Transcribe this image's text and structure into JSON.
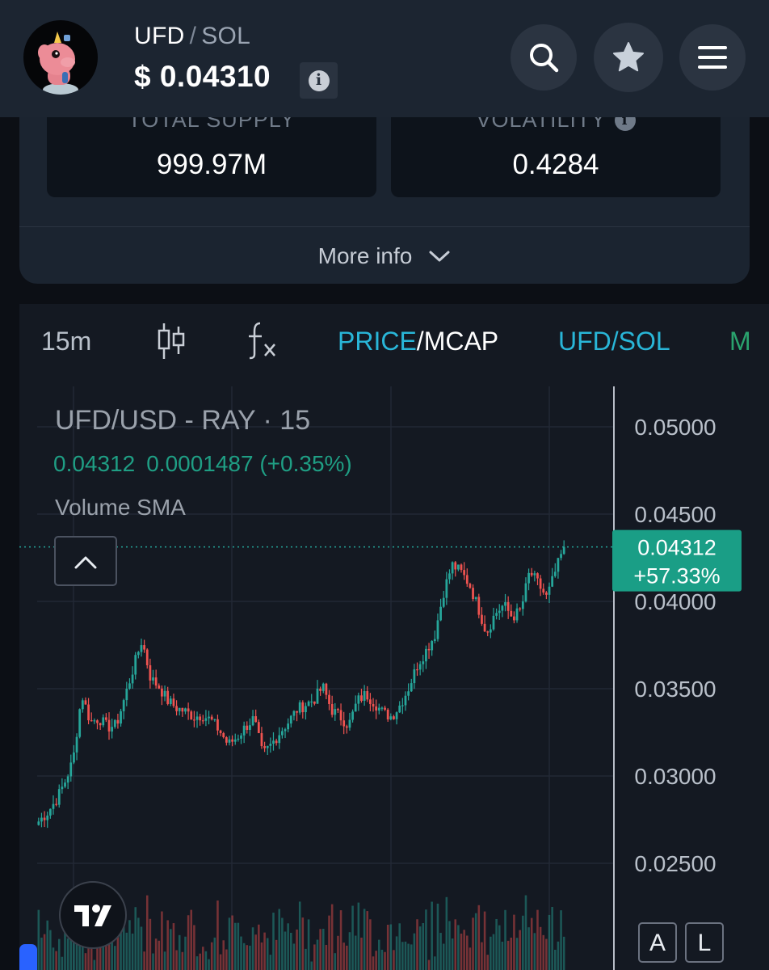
{
  "header": {
    "base": "UFD",
    "separator": "/",
    "quote": "SOL",
    "price": "$ 0.04310",
    "info_glyph": "i"
  },
  "stats": {
    "total_supply_label": "TOTAL SUPPLY",
    "total_supply_value": "999.97M",
    "volatility_label": "VOLATILITY",
    "volatility_value": "0.4284",
    "volatility_info_glyph": "i"
  },
  "more_info_label": "More info",
  "chart_toolbar": {
    "interval": "15m",
    "price_label": "PRICE",
    "separator": "/",
    "mcap_label": "MCAP",
    "pair_label": "UFD/SOL",
    "cut_label": "M"
  },
  "chart_legend": {
    "title": "UFD/USD - RAY · 15",
    "last_value": "0.04312",
    "change": "0.0001487 (+0.35%)",
    "indicator": "Volume SMA"
  },
  "price_tag": {
    "price": "0.04312",
    "change_pct": "+57.33%"
  },
  "scale_buttons": {
    "auto": "A",
    "log": "L"
  },
  "colors": {
    "up": "#26a69a",
    "down": "#ef5350",
    "accent": "#29b6d8",
    "green_text": "#1f9e84"
  },
  "chart_data": {
    "type": "candlestick",
    "title": "UFD/USD - RAY · 15",
    "y_ticks": [
      0.05,
      0.045,
      0.04,
      0.035,
      0.03,
      0.025
    ],
    "y_tick_labels": [
      "0.05000",
      "0.04500",
      "0.04000",
      "0.03500",
      "0.03000",
      "0.02500"
    ],
    "ylim": [
      0.0222,
      0.0522
    ],
    "last_price": 0.04312,
    "change_pct": 57.33,
    "candle_count": 180,
    "close_series": [
      0.0274,
      0.0279,
      0.0286,
      0.0296,
      0.0309,
      0.0347,
      0.0331,
      0.0333,
      0.0328,
      0.0329,
      0.0345,
      0.0362,
      0.0378,
      0.0356,
      0.0351,
      0.0343,
      0.0339,
      0.0337,
      0.0334,
      0.0335,
      0.0332,
      0.0326,
      0.0318,
      0.0322,
      0.0328,
      0.0333,
      0.0312,
      0.0318,
      0.0325,
      0.0331,
      0.0338,
      0.0341,
      0.0344,
      0.0351,
      0.0338,
      0.0334,
      0.0329,
      0.0343,
      0.0347,
      0.0342,
      0.0336,
      0.0334,
      0.0341,
      0.0351,
      0.0364,
      0.0372,
      0.0381,
      0.0405,
      0.0421,
      0.0417,
      0.041,
      0.0397,
      0.0382,
      0.0393,
      0.0398,
      0.0391,
      0.0395,
      0.0417,
      0.041,
      0.0402,
      0.0417,
      0.0431
    ]
  },
  "watermark": "TradingView"
}
